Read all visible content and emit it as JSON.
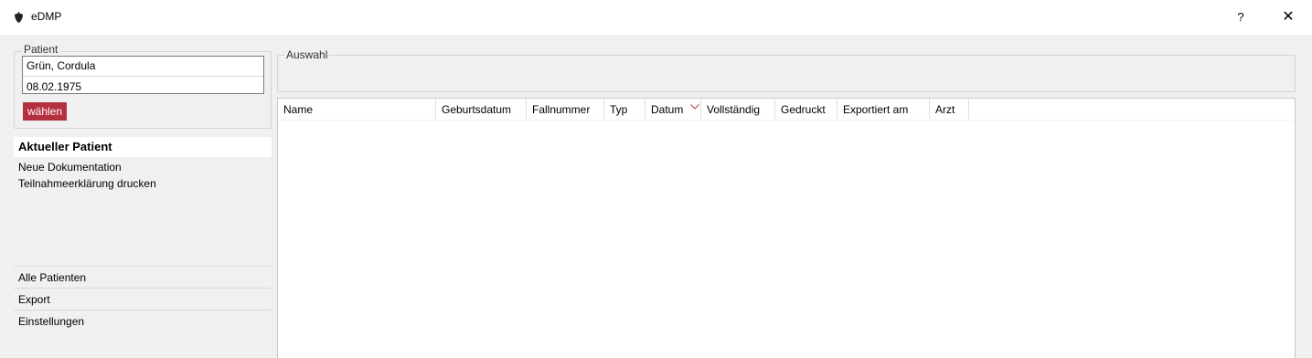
{
  "window": {
    "title": "eDMP",
    "help_label": "?",
    "close_label": "✕",
    "icon": "acorn-icon"
  },
  "patient": {
    "legend": "Patient",
    "name": "Grün, Cordula",
    "dob": "08.02.1975",
    "select_label": "wählen"
  },
  "nav": {
    "current": "Aktueller Patient",
    "items_top": [
      "Neue Dokumentation",
      "Teilnahmeerklärung drucken"
    ],
    "items_bottom": [
      "Alle Patienten",
      "Export",
      "Einstellungen"
    ]
  },
  "auswahl": {
    "legend": "Auswahl"
  },
  "table": {
    "columns": [
      "Name",
      "Geburtsdatum",
      "Fallnummer",
      "Typ",
      "Datum",
      "Vollständig",
      "Gedruckt",
      "Exportiert am",
      "Arzt"
    ],
    "sorted_column": "Datum",
    "sort_direction": "descending",
    "rows": []
  },
  "colors": {
    "accent": "#b4303f",
    "background": "#f0f0f0"
  }
}
